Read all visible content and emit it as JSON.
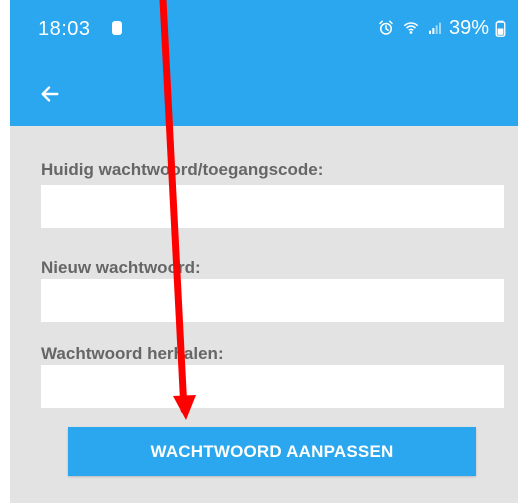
{
  "status_bar": {
    "time": "18:03",
    "battery_text": "39%",
    "left_icon": "battery-saver-icon",
    "right_icons": [
      "alarm-icon",
      "wifi-icon",
      "signal-icon",
      "battery-icon"
    ]
  },
  "toolbar": {
    "back_icon": "arrow-left-icon"
  },
  "form": {
    "current_password": {
      "label": "Huidig wachtwoord/toegangscode:",
      "value": "",
      "placeholder": ""
    },
    "new_password": {
      "label": "Nieuw wachtwoord:",
      "value": "",
      "placeholder": ""
    },
    "repeat_password": {
      "label": "Wachtwoord herhalen:",
      "value": "",
      "placeholder": ""
    },
    "submit_label": "WACHTWOORD AANPASSEN"
  },
  "colors": {
    "accent": "#2aa7ee",
    "page_background": "#e3e3e3",
    "label_text": "#666666",
    "annotation": "#ff0000"
  }
}
